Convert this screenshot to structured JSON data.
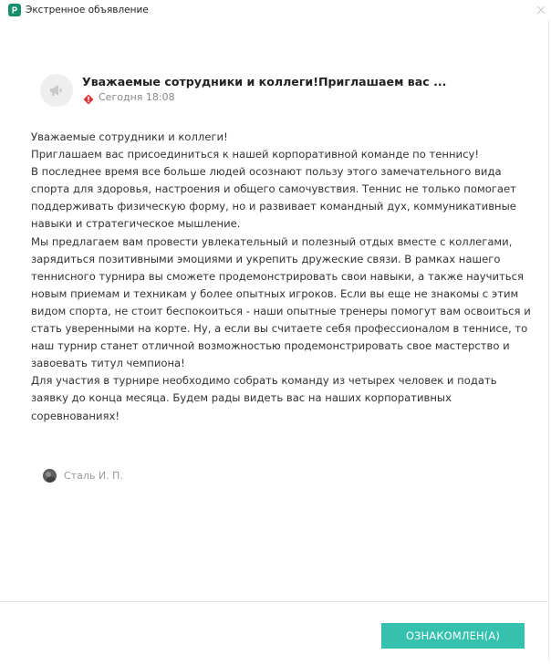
{
  "window": {
    "title": "Экстренное объявление",
    "app_icon": "app-logo-icon",
    "close_icon": "close-icon"
  },
  "post": {
    "title": "Уважаемые сотрудники и коллеги!Приглашаем вас ...",
    "timestamp": "Сегодня 18:08",
    "type_icon": "megaphone-icon",
    "priority_icon": "urgent-diamond-icon",
    "priority_color": "#d9343a",
    "body_lines": [
      "Уважаемые сотрудники и коллеги!",
      "Приглашаем вас присоединиться к нашей корпоративной команде по теннису!",
      "В последнее время все больше людей осознают пользу этого замечательного вида спорта для здоровья, настроения и общего самочувствия. Теннис не только помогает поддерживать физическую форму, но и развивает командный дух, коммуникативные навыки и стратегическое мышление.",
      "Мы предлагаем вам провести увлекательный и полезный отдых вместе с коллегами, зарядиться позитивными эмоциями и укрепить дружеские связи. В рамках нашего теннисного турнира вы сможете продемонстрировать свои навыки, а также научиться новым приемам и техникам у более опытных игроков. Если вы еще не знакомы с этим видом спорта, не стоит беспокоиться - наши опытные тренеры помогут вам освоиться и стать уверенными на корте. Ну, а если вы считаете себя профессионалом в теннисе, то наш турнир станет отличной возможностью продемонстрировать свое мастерство и завоевать титул чемпиона!",
      "Для участия в турнире необходимо собрать команду из четырех человек и подать заявку до конца месяца. Будем рады видеть вас на наших корпоративных соревнованиях!"
    ],
    "author": "Сталь И. П."
  },
  "footer": {
    "ack_button_label": "ОЗНАКОМЛЕН(А)",
    "accent_color": "#36c1ae"
  }
}
